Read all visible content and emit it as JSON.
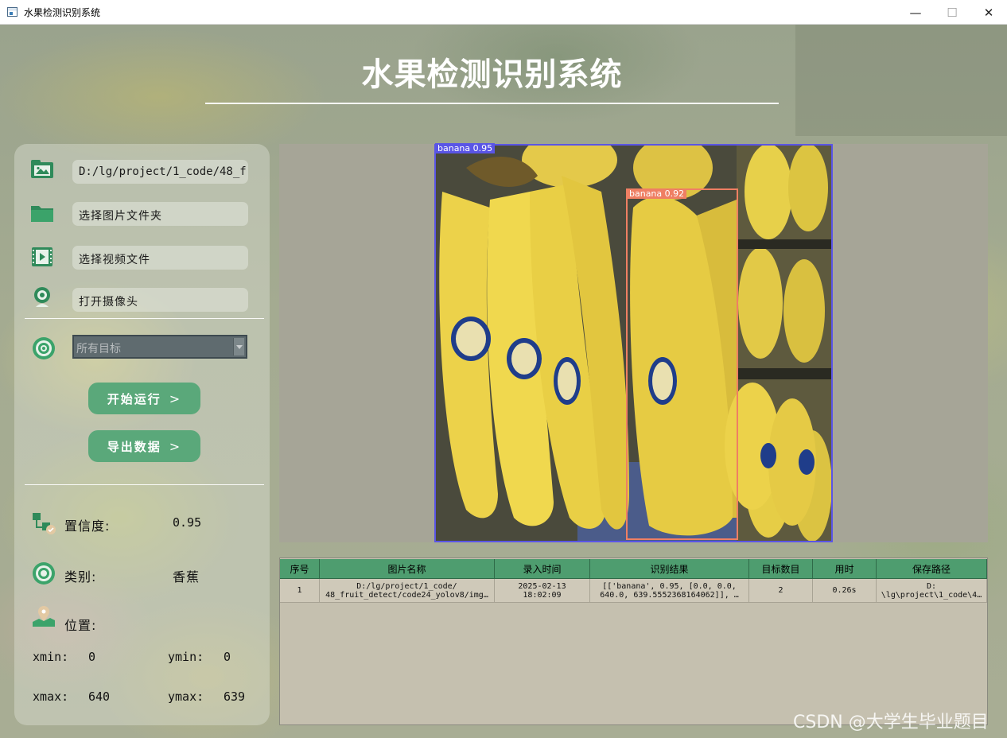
{
  "window": {
    "title": "水果检测识别系统",
    "min_glyph": "—",
    "max_glyph": "☐",
    "close_glyph": "✕"
  },
  "header": {
    "title": "水果检测识别系统"
  },
  "sidebar": {
    "image_path": "D:/lg/project/1_code/48_fruit_detect",
    "folder_label": "选择图片文件夹",
    "video_label": "选择视频文件",
    "camera_label": "打开摄像头",
    "target_select": {
      "placeholder": "所有目标"
    },
    "run_button": "开始运行",
    "export_button": "导出数据",
    "chevron": ">",
    "confidence_label": "置信度:",
    "confidence_value": "0.95",
    "class_label": "类别:",
    "class_value": "香蕉",
    "position_label": "位置:",
    "xmin_label": "xmin:",
    "xmin_value": "0",
    "ymin_label": "ymin:",
    "ymin_value": "0",
    "xmax_label": "xmax:",
    "xmax_value": "640",
    "ymax_label": "ymax:",
    "ymax_value": "639"
  },
  "detections": [
    {
      "label": "banana 0.95",
      "color": "#5a55e6"
    },
    {
      "label": "banana 0.92",
      "color": "#ef7f63"
    }
  ],
  "table": {
    "headers": [
      "序号",
      "图片名称",
      "录入时间",
      "识别结果",
      "目标数目",
      "用时",
      "保存路径"
    ],
    "rows": [
      [
        "1",
        "D:/lg/project/1_code/\n48_fruit_detect/code24_yolov8/img…",
        "2025-02-13\n18:02:09",
        "[['banana', 0.95, [0.0, 0.0,\n640.0, 639.5552368164062]], …",
        "2",
        "0.26s",
        "D:\n\\lg\\project\\1_code\\4…"
      ]
    ]
  },
  "watermark": "CSDN @大学生毕业题目",
  "colors": {
    "accent": "#5aa87a",
    "table_header": "#4e9d6f",
    "box_blue": "#5a55e6",
    "box_orange": "#ef7f63"
  }
}
